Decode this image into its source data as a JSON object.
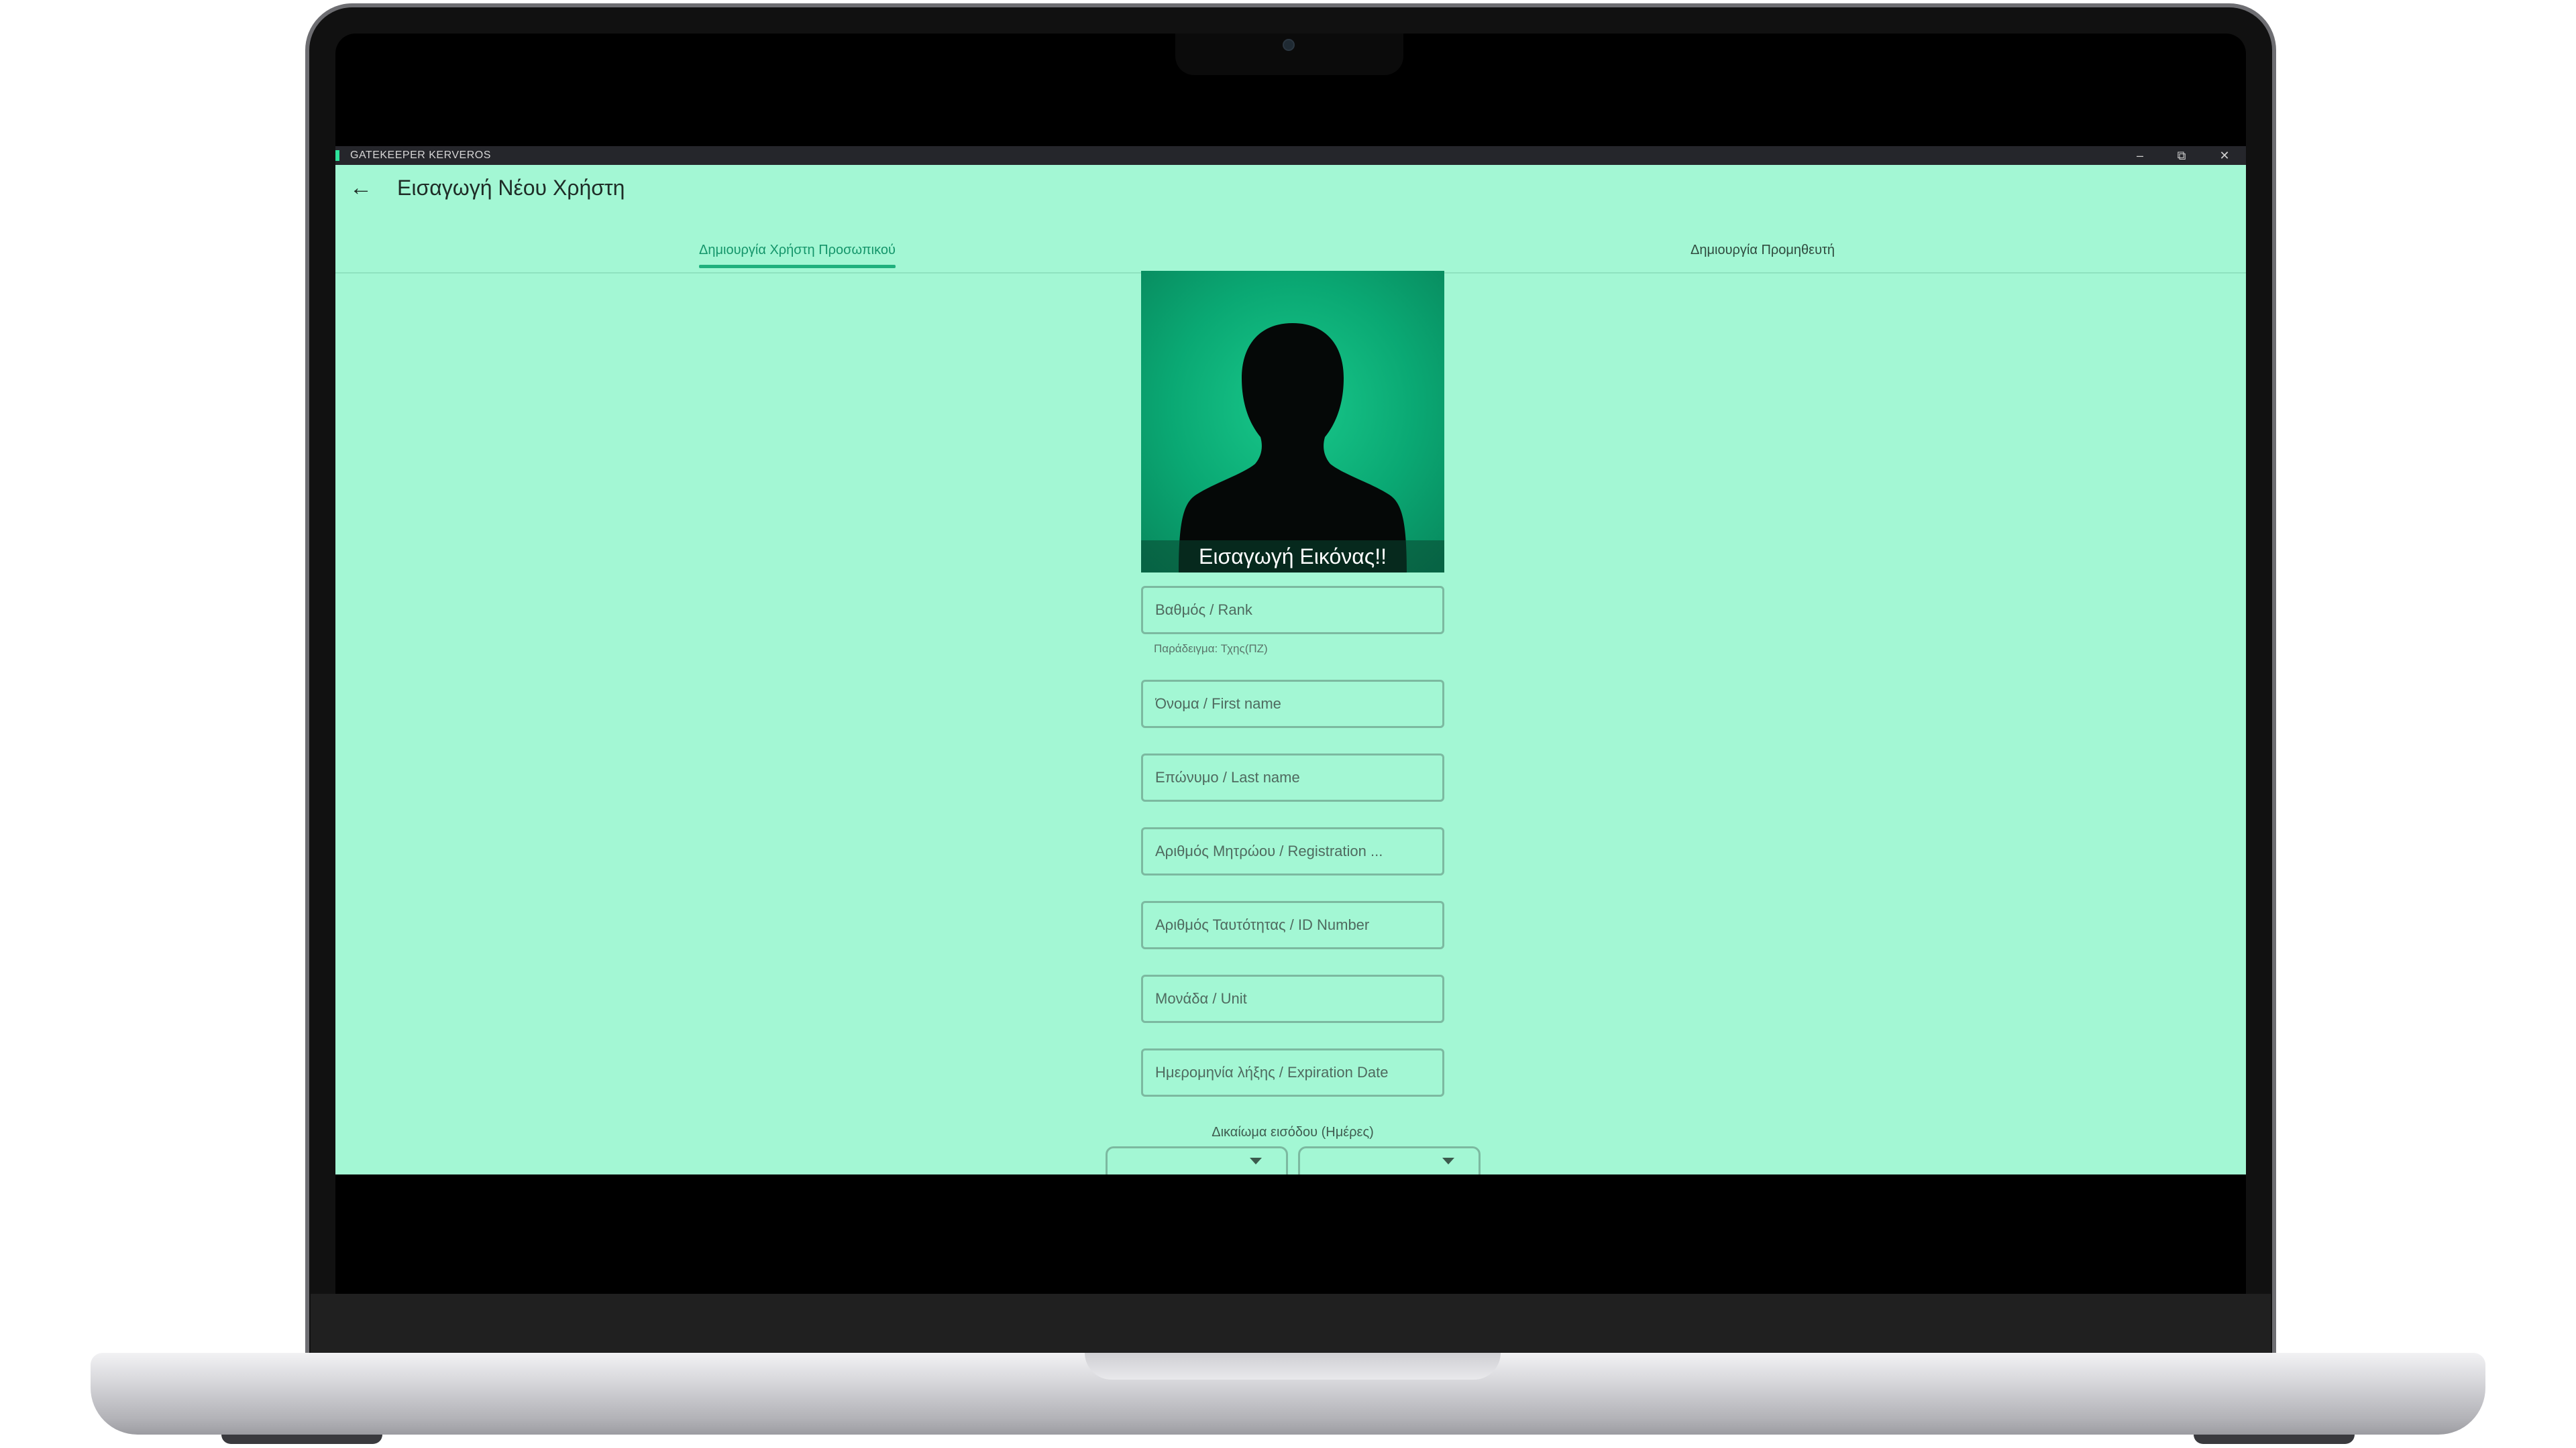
{
  "window": {
    "title": "GATEKEEPER KERVEROS",
    "minimize_glyph": "–",
    "maximize_glyph": "⧉",
    "close_glyph": "✕"
  },
  "appbar": {
    "back_glyph": "←",
    "title": "Εισαγωγή Νέου Χρήστη"
  },
  "tabs": [
    {
      "label": "Δημιουργία Χρήστη Προσωπικού",
      "active": true
    },
    {
      "label": "Δημιουργία Προμηθευτή",
      "active": false
    }
  ],
  "photo": {
    "caption": "Εισαγωγή Εικόνας!!"
  },
  "form": {
    "rank_placeholder": "Βαθμός / Rank",
    "rank_helper": "Παράδειγμα: Τχης(ΠΖ)",
    "first_name_placeholder": "Όνομα / First name",
    "last_name_placeholder": "Επώνυμο / Last name",
    "registration_placeholder": "Αριθμός Μητρώου / Registration ...",
    "id_number_placeholder": "Αριθμός Ταυτότητας / ID Number",
    "unit_placeholder": "Μονάδα / Unit",
    "expiration_placeholder": "Ημερομηνία λήξης / Expiration Date",
    "entry_rights_label": "Δικαίωμα εισόδου (Ημέρες)"
  },
  "colors": {
    "window_background": "#a3f7d4",
    "accent": "#1fb07d",
    "titlebar": "#25262b",
    "field_border": "#7cb9a0"
  },
  "icons": [
    "back-arrow-icon",
    "minimize-icon",
    "maximize-icon",
    "close-icon",
    "user-silhouette-icon",
    "chevron-down-icon"
  ]
}
